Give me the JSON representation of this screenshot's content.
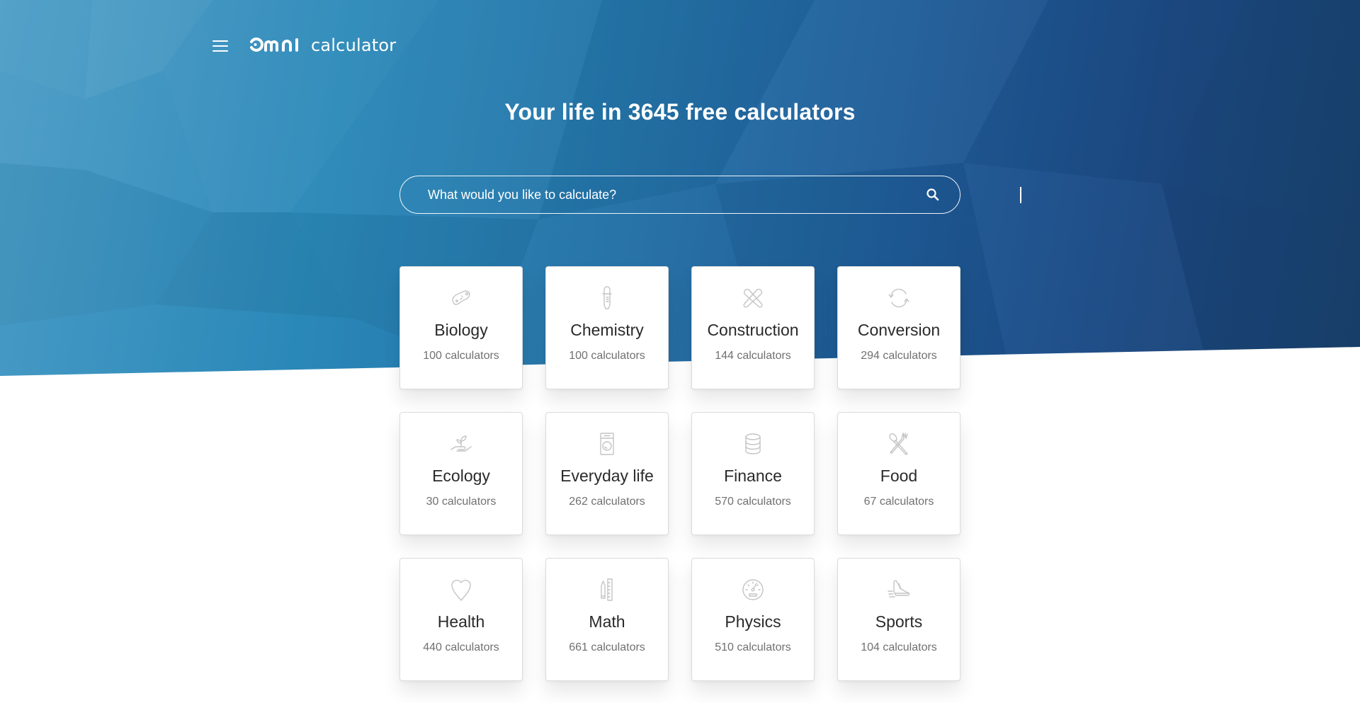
{
  "header": {
    "menu_icon": "hamburger-menu-icon",
    "logo_mark": "omni",
    "logo_word": "calculator"
  },
  "hero": {
    "title": "Your life in 3645 free calculators",
    "colors": {
      "gradient_start": "#4a9cc6",
      "gradient_end": "#19426e",
      "text": "#ffffff"
    }
  },
  "search": {
    "placeholder": "What would you like to calculate?",
    "value": "",
    "button_icon": "search-icon"
  },
  "categories": [
    {
      "name": "Biology",
      "count": "100 calculators",
      "icon": "bacteria-icon"
    },
    {
      "name": "Chemistry",
      "count": "100 calculators",
      "icon": "test-tube-icon"
    },
    {
      "name": "Construction",
      "count": "144 calculators",
      "icon": "crossed-wrenches-icon"
    },
    {
      "name": "Conversion",
      "count": "294 calculators",
      "icon": "refresh-arrows-icon"
    },
    {
      "name": "Ecology",
      "count": "30 calculators",
      "icon": "plant-in-hand-icon"
    },
    {
      "name": "Everyday life",
      "count": "262 calculators",
      "icon": "washing-machine-icon"
    },
    {
      "name": "Finance",
      "count": "570 calculators",
      "icon": "coin-stack-icon"
    },
    {
      "name": "Food",
      "count": "67 calculators",
      "icon": "fork-spoon-icon"
    },
    {
      "name": "Health",
      "count": "440 calculators",
      "icon": "heart-icon"
    },
    {
      "name": "Math",
      "count": "661 calculators",
      "icon": "pencil-ruler-icon"
    },
    {
      "name": "Physics",
      "count": "510 calculators",
      "icon": "speedometer-icon"
    },
    {
      "name": "Sports",
      "count": "104 calculators",
      "icon": "running-shoe-icon"
    }
  ],
  "colors": {
    "card_title": "#2a2a2a",
    "card_count": "#707070",
    "icon_stroke": "#c4c4c4"
  }
}
